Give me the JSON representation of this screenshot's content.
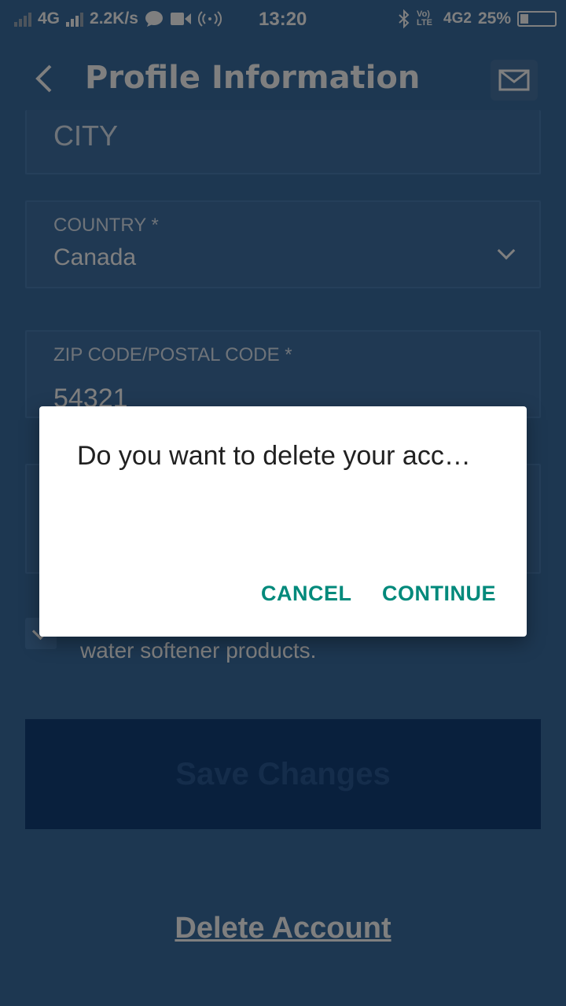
{
  "status_bar": {
    "network_left": "4G",
    "speed": "2.2K/s",
    "time": "13:20",
    "volte": "Vo) LTE",
    "network_right": "4G2",
    "battery": "25%"
  },
  "header": {
    "title": "Profile Information",
    "back_icon": "chevron-left-icon",
    "mail_icon": "mail-icon"
  },
  "form": {
    "city": {
      "label": "CITY",
      "value": ""
    },
    "country": {
      "label": "COUNTRY *",
      "value": "Canada"
    },
    "zip": {
      "label": "ZIP CODE/POSTAL CODE *",
      "value": "54321"
    },
    "consent_text": "water softener products.",
    "save_label": "Save Changes",
    "delete_label": "Delete Account"
  },
  "dialog": {
    "title": "Do you want to delete your acc…",
    "cancel_label": "CANCEL",
    "continue_label": "CONTINUE"
  },
  "colors": {
    "background": "#3b6fa3",
    "dialog_accent": "#00897b",
    "save_button": "#13417a"
  }
}
